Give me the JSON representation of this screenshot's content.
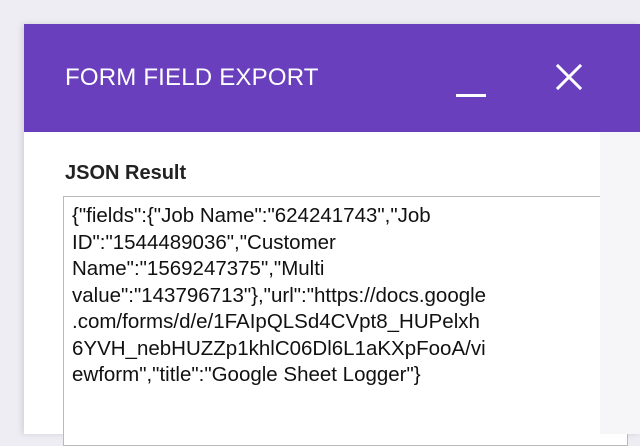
{
  "dialog": {
    "title": "FORM FIELD EXPORT",
    "minimize_icon": "minimize-icon",
    "close_icon": "close-icon"
  },
  "content": {
    "section_label": "JSON Result",
    "result_lines": [
      "{\"fields\":{\"Job Name\":\"624241743\",\"Job",
      "ID\":\"1544489036\",\"Customer",
      "Name\":\"1569247375\",\"Multi",
      "value\":\"143796713\"},\"url\":\"https://docs.google",
      ".com/forms/d/e/1FAIpQLSd4CVpt8_HUPelxh",
      "6YVH_nebHUZZp1khlC06Dl6L1aKXpFooA/vi",
      "ewform\",\"title\":\"Google Sheet Logger\"}"
    ]
  },
  "colors": {
    "header": "#6a3fbd",
    "page_background": "#eeedf3",
    "text": "#111111"
  }
}
